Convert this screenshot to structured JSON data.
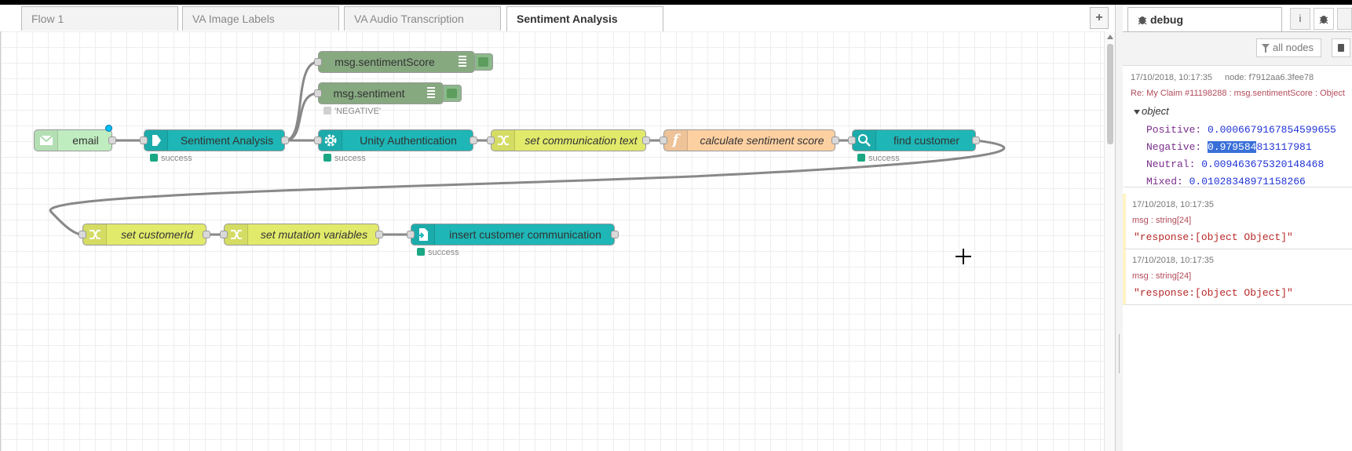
{
  "tabs": [
    {
      "label": "Flow 1",
      "active": false
    },
    {
      "label": "VA Image Labels",
      "active": false
    },
    {
      "label": "VA Audio Transcription",
      "active": false
    },
    {
      "label": "Sentiment Analysis",
      "active": true
    }
  ],
  "add_tab_label": "+",
  "nodes": {
    "email": {
      "label": "email",
      "color": "#c0edc0"
    },
    "sentiment_analysis": {
      "label": "Sentiment Analysis",
      "status": "success",
      "color": "#1eb6b6"
    },
    "msg_sentiment_score": {
      "label": "msg.sentimentScore",
      "color": "#87a980"
    },
    "msg_sentiment": {
      "label": "msg.sentiment",
      "status": "'NEGATIVE'",
      "color": "#87a980"
    },
    "unity_auth": {
      "label": "Unity Authentication",
      "status": "success",
      "color": "#1eb6b6"
    },
    "set_comm_text": {
      "label": "set communication text",
      "color": "#e2ea6b"
    },
    "calc_sentiment": {
      "label": "calculate sentiment score",
      "color": "#fdd0a2"
    },
    "find_customer": {
      "label": "find customer",
      "status": "success",
      "color": "#1eb6b6"
    },
    "set_customer_id": {
      "label": "set customerId",
      "color": "#e2ea6b"
    },
    "set_mutation_vars": {
      "label": "set mutation variables",
      "color": "#e2ea6b"
    },
    "insert_comm": {
      "label": "insert customer communication",
      "status": "success",
      "color": "#1eb6b6"
    }
  },
  "status_colors": {
    "success": "#1aa784",
    "grey": "#d0d0d0"
  },
  "sidebar": {
    "tab_label": "debug",
    "info_icon": "i",
    "filter_label": "all nodes",
    "messages": [
      {
        "timestamp": "17/10/2018, 10:17:35",
        "node": "node: f7912aa6.3fee78",
        "topic": "Re: My Claim #11198288 : msg.sentimentScore : Object",
        "object_label": "object",
        "props": [
          {
            "key": "Positive:",
            "value": "0.0006679167854599655"
          },
          {
            "key": "Negative:",
            "value_hl": "0.979584",
            "value_rest": "813117981"
          },
          {
            "key": "Neutral:",
            "value": "0.009463675320148468"
          },
          {
            "key": "Mixed:",
            "value": "0.01028348971158266"
          }
        ]
      },
      {
        "timestamp": "17/10/2018, 10:17:35",
        "type": "msg : string[24]",
        "value": "\"response:[object Object]\""
      },
      {
        "timestamp": "17/10/2018, 10:17:35",
        "type": "msg : string[24]",
        "value": "\"response:[object Object]\""
      }
    ]
  }
}
